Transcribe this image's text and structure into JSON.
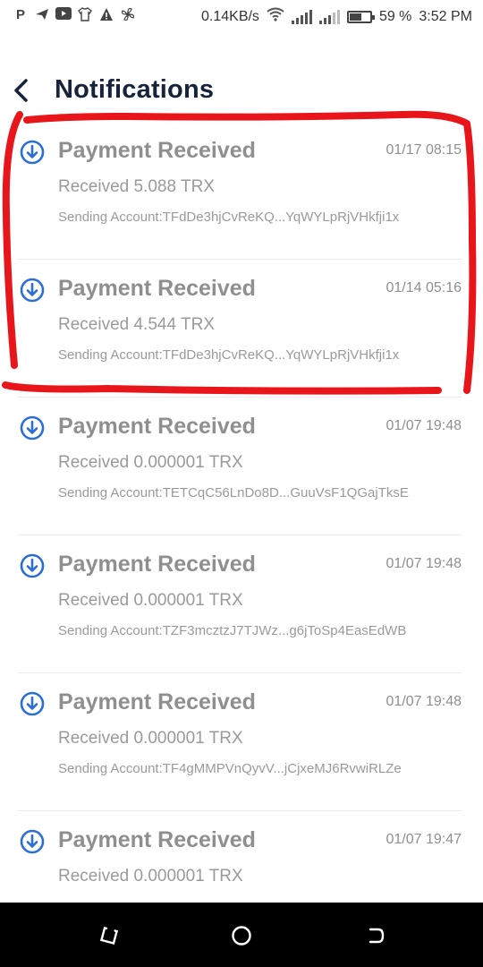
{
  "status_bar": {
    "left_icons": [
      "p-icon",
      "send-icon",
      "youtube-icon",
      "shirt-icon",
      "warning-icon",
      "fan-icon"
    ],
    "network_speed": "0.14KB/s",
    "battery": "59 %",
    "battery_level": 0.59,
    "time": "3:52 PM"
  },
  "header": {
    "title": "Notifications"
  },
  "notifications": [
    {
      "title": "Payment Received",
      "time": "01/17 08:15",
      "amount": "Received 5.088 TRX",
      "account": "Sending Account:TFdDe3hjCvReKQ...YqWYLpRjVHkfji1x"
    },
    {
      "title": "Payment Received",
      "time": "01/14 05:16",
      "amount": "Received 4.544 TRX",
      "account": "Sending Account:TFdDe3hjCvReKQ...YqWYLpRjVHkfji1x"
    },
    {
      "title": "Payment Received",
      "time": "01/07 19:48",
      "amount": "Received 0.000001 TRX",
      "account": "Sending Account:TETCqC56LnDo8D...GuuVsF1QGajTksE"
    },
    {
      "title": "Payment Received",
      "time": "01/07 19:48",
      "amount": "Received 0.000001 TRX",
      "account": "Sending Account:TZF3mcztzJ7TJWz...g6jToSp4EasEdWB"
    },
    {
      "title": "Payment Received",
      "time": "01/07 19:48",
      "amount": "Received 0.000001 TRX",
      "account": "Sending Account:TF4gMMPVnQyvV...jCjxeMJ6RvwiRLZe"
    },
    {
      "title": "Payment Received",
      "time": "01/07 19:47",
      "amount": "Received 0.000001 TRX",
      "account": ""
    }
  ],
  "colors": {
    "title": "#16233a",
    "icon": "#2b6fd6",
    "highlight": "#e8151b",
    "nav_bar": "#000000"
  }
}
